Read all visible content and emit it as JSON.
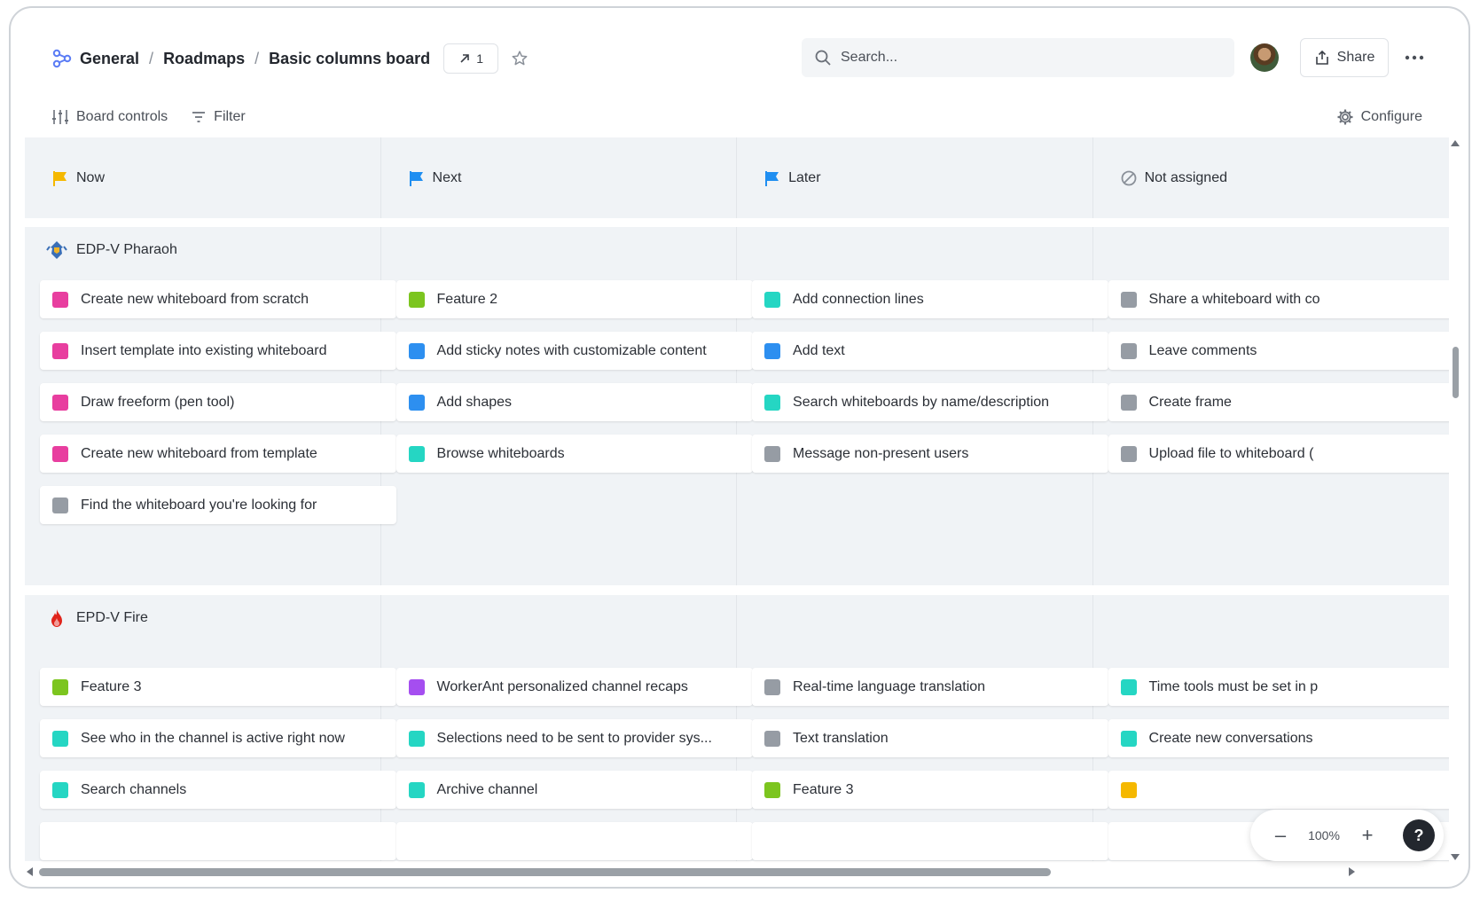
{
  "breadcrumb": {
    "items": [
      "General",
      "Roadmaps",
      "Basic columns board"
    ],
    "separator": "/"
  },
  "header": {
    "link_count": "1",
    "search_placeholder": "Search...",
    "share_label": "Share"
  },
  "controls": {
    "board_controls_label": "Board controls",
    "filter_label": "Filter",
    "configure_label": "Configure"
  },
  "columns": [
    {
      "label": "Now",
      "icon": "flag-yellow-icon",
      "color": "#f5b800"
    },
    {
      "label": "Next",
      "icon": "flag-blue-icon",
      "color": "#1f8ef1"
    },
    {
      "label": "Later",
      "icon": "flag-blue-icon",
      "color": "#1f8ef1"
    },
    {
      "label": "Not assigned",
      "icon": "not-assigned-icon",
      "color": "#8a9099"
    }
  ],
  "lanes": [
    {
      "title": "EDP-V Pharaoh",
      "icon": "pharaoh-icon",
      "columns": [
        [
          {
            "label": "Create new whiteboard from scratch",
            "color": "#e83e9f"
          },
          {
            "label": "Insert template into existing whiteboard",
            "color": "#e83e9f"
          },
          {
            "label": "Draw freeform (pen tool)",
            "color": "#e83e9f"
          },
          {
            "label": "Create new whiteboard from template",
            "color": "#e83e9f"
          },
          {
            "label": "Find the whiteboard you're looking for",
            "color": "#969ca4"
          }
        ],
        [
          {
            "label": "Feature 2",
            "color": "#7cc51f"
          },
          {
            "label": "Add sticky notes with customizable content",
            "color": "#2d8ff0"
          },
          {
            "label": "Add shapes",
            "color": "#2d8ff0"
          },
          {
            "label": "Browse whiteboards",
            "color": "#25d6c3"
          }
        ],
        [
          {
            "label": "Add connection lines",
            "color": "#25d6c3"
          },
          {
            "label": "Add text",
            "color": "#2d8ff0"
          },
          {
            "label": "Search whiteboards by name/description",
            "color": "#25d6c3"
          },
          {
            "label": "Message non-present users",
            "color": "#969ca4"
          }
        ],
        [
          {
            "label": "Share a whiteboard with co",
            "color": "#969ca4"
          },
          {
            "label": "Leave comments",
            "color": "#969ca4"
          },
          {
            "label": "Create frame",
            "color": "#969ca4"
          },
          {
            "label": "Upload file to whiteboard (",
            "color": "#969ca4"
          }
        ]
      ]
    },
    {
      "title": "EPD-V Fire",
      "icon": "fire-icon",
      "columns": [
        [
          {
            "label": "Feature 3",
            "color": "#7cc51f"
          },
          {
            "label": "See who in the channel is active right now",
            "color": "#25d6c3"
          },
          {
            "label": "Search channels",
            "color": "#25d6c3"
          },
          {
            "label": "",
            "color": ""
          }
        ],
        [
          {
            "label": "WorkerAnt personalized channel recaps",
            "color": "#a54ef0"
          },
          {
            "label": "Selections need to be sent to provider sys...",
            "color": "#25d6c3"
          },
          {
            "label": "Archive channel",
            "color": "#25d6c3"
          },
          {
            "label": "",
            "color": ""
          }
        ],
        [
          {
            "label": "Real-time language translation",
            "color": "#969ca4"
          },
          {
            "label": "Text translation",
            "color": "#969ca4"
          },
          {
            "label": "Feature 3",
            "color": "#7cc51f"
          },
          {
            "label": "",
            "color": ""
          }
        ],
        [
          {
            "label": "Time tools must be set in p",
            "color": "#25d6c3"
          },
          {
            "label": "Create new conversations",
            "color": "#25d6c3"
          },
          {
            "label": "",
            "color": "#f5b800"
          },
          {
            "label": "",
            "color": ""
          }
        ]
      ]
    }
  ],
  "zoom": {
    "level": "100%",
    "minus": "–",
    "plus": "+",
    "help": "?"
  }
}
